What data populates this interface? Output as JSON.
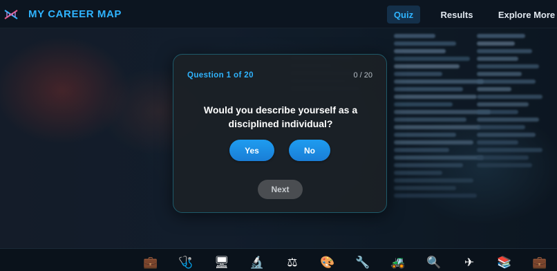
{
  "header": {
    "brand": "MY CAREER MAP",
    "logo_icon": "dna-icon",
    "nav": [
      {
        "label": "Quiz",
        "active": true
      },
      {
        "label": "Results",
        "active": false
      },
      {
        "label": "Explore More",
        "active": false
      }
    ]
  },
  "quiz": {
    "counter": "Question 1 of 20",
    "progress": "0 / 20",
    "question": "Would you describe yourself as a disciplined individual?",
    "yes_label": "Yes",
    "no_label": "No",
    "next_label": "Next",
    "next_enabled": false
  },
  "footer": {
    "icons": [
      {
        "name": "briefcase-icon",
        "glyph": "💼"
      },
      {
        "name": "stethoscope-icon",
        "glyph": "🩺"
      },
      {
        "name": "computer-icon",
        "glyph": "🖥"
      },
      {
        "name": "microscope-icon",
        "glyph": "🔬"
      },
      {
        "name": "scales-icon",
        "glyph": "⚖"
      },
      {
        "name": "palette-icon",
        "glyph": "🎨"
      },
      {
        "name": "wrench-icon",
        "glyph": "🔧"
      },
      {
        "name": "tractor-icon",
        "glyph": "🚜"
      },
      {
        "name": "magnifier-icon",
        "glyph": "🔍"
      },
      {
        "name": "airplane-icon",
        "glyph": "✈"
      },
      {
        "name": "books-icon",
        "glyph": "📚"
      },
      {
        "name": "briefcase-icon",
        "glyph": "💼"
      }
    ]
  },
  "colors": {
    "accent": "#2fb4ff",
    "button": "#1a8ae0",
    "card_border": "#1e5a6a",
    "next_disabled": "#4a4d51"
  }
}
